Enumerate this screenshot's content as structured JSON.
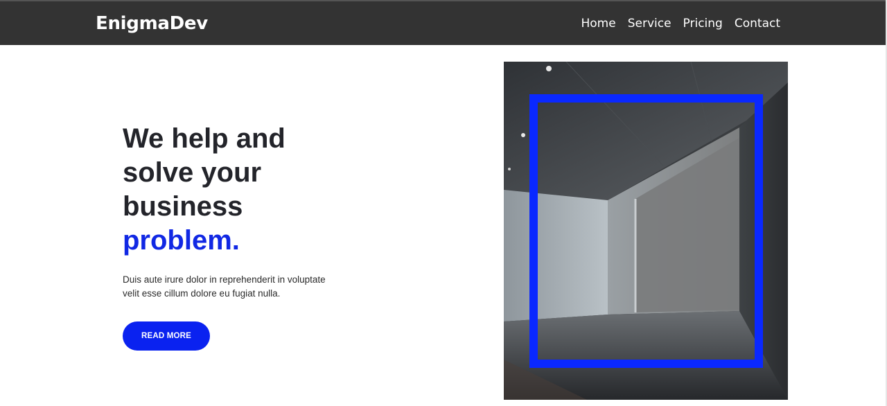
{
  "brand": {
    "name": "EnigmaDev"
  },
  "nav": {
    "items": [
      {
        "label": "Home"
      },
      {
        "label": "Service"
      },
      {
        "label": "Pricing"
      },
      {
        "label": "Contact"
      }
    ]
  },
  "hero": {
    "title_lines": [
      "We help and",
      "solve your",
      "business"
    ],
    "title_accent": "problem.",
    "description": "Duis aute irure dolor in reprehenderit in voluptate velit esse cillum dolore eu fugiat nulla.",
    "cta_label": "READ MORE"
  },
  "colors": {
    "navbar": "#333333",
    "accent": "#0a22f0",
    "frame": "#0a28ff",
    "text": "#23242a"
  }
}
